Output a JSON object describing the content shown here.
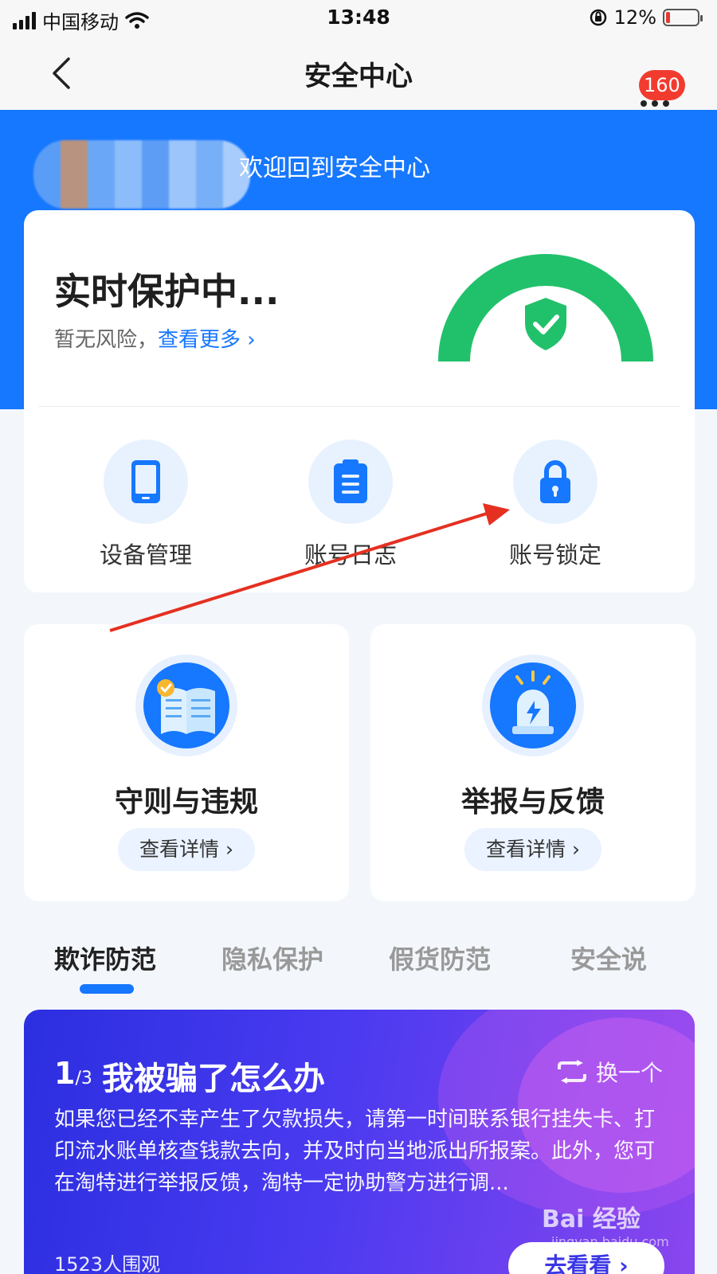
{
  "status_bar": {
    "carrier": "中国移动",
    "time": "13:48",
    "battery": "12%",
    "battery_level": 0.12
  },
  "nav": {
    "title": "安全中心",
    "badge": "160",
    "back_icon": "chevron-left-icon",
    "more_icon": "more-dots-icon"
  },
  "banner": {
    "welcome": "欢迎回到安全中心"
  },
  "protection": {
    "title": "实时保护中...",
    "status": "暂无风险，",
    "more_link": "查看更多",
    "quick_actions": [
      {
        "label": "设备管理",
        "icon": "phone-icon"
      },
      {
        "label": "账号日志",
        "icon": "clipboard-icon"
      },
      {
        "label": "账号锁定",
        "icon": "lock-icon"
      }
    ]
  },
  "features": [
    {
      "title": "守则与违规",
      "button": "查看详情",
      "icon": "rulebook-icon"
    },
    {
      "title": "举报与反馈",
      "button": "查看详情",
      "icon": "alarm-icon"
    }
  ],
  "tabs": [
    "欺诈防范",
    "隐私保护",
    "假货防范",
    "安全说"
  ],
  "tip": {
    "index": "1",
    "total": "/3",
    "title": "我被骗了怎么办",
    "switch_label": "换一个",
    "body": "如果您已经不幸产生了欠款损失，请第一时间联系银行挂失卡、打印流水账单核查钱款去向，并及时向当地派出所报案。此外，您可在淘特进行举报反馈，淘特一定协助警方进行调...",
    "views": "1523人围观",
    "go_button": "去看看 ›"
  },
  "watermark": {
    "brand": "Bai 经验",
    "url": "jingyan.baidu.com"
  },
  "colors": {
    "primary": "#1677ff",
    "safe_green": "#21c16b",
    "badge_red": "#f23b2f",
    "annotation_red": "#e53021"
  }
}
